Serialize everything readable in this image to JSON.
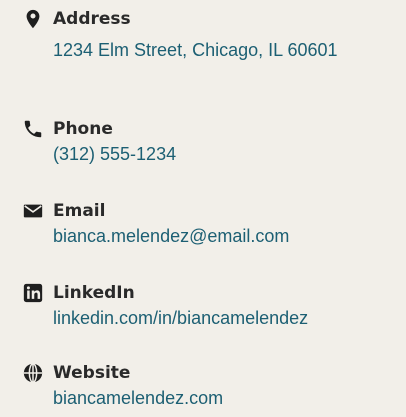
{
  "contacts": [
    {
      "icon": "location-pin-icon",
      "label": "Address",
      "value": "1234 Elm Street, Chicago, IL 60601"
    },
    {
      "icon": "phone-icon",
      "label": "Phone",
      "value": "(312) 555-1234"
    },
    {
      "icon": "envelope-icon",
      "label": "Email",
      "value": "bianca.melendez@email.com"
    },
    {
      "icon": "linkedin-icon",
      "label": "LinkedIn",
      "value": "linkedin.com/in/biancamelendez"
    },
    {
      "icon": "globe-icon",
      "label": "Website",
      "value": "biancamelendez.com"
    }
  ],
  "colors": {
    "background": "#f2efe9",
    "label": "#2a2a2a",
    "value": "#1c5f73",
    "icon": "#1f1f1f"
  }
}
